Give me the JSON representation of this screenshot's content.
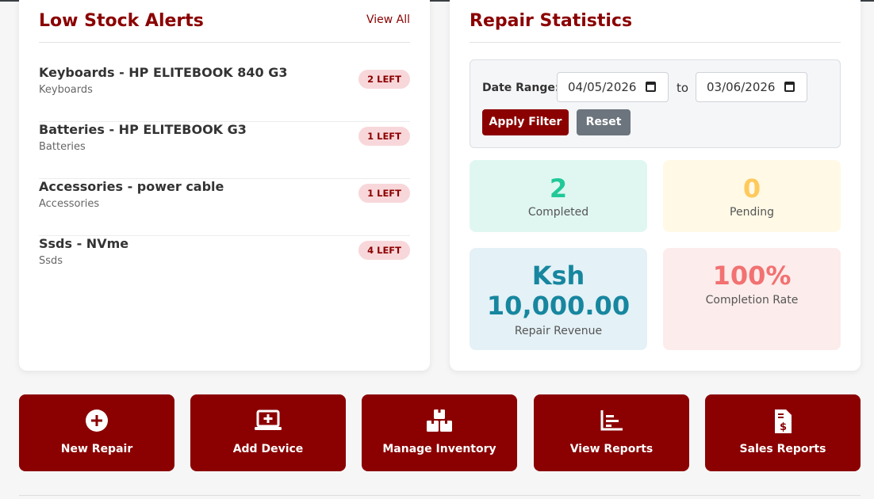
{
  "low_stock": {
    "title": "Low Stock Alerts",
    "view_all": "View All",
    "items": [
      {
        "name": "Keyboards - HP ELITEBOOK 840 G3",
        "category": "Keyboards",
        "badge": "2 LEFT"
      },
      {
        "name": "Batteries - HP ELITEBOOK G3",
        "category": "Batteries",
        "badge": "1 LEFT"
      },
      {
        "name": "Accessories - power cable",
        "category": "Accessories",
        "badge": "1 LEFT"
      },
      {
        "name": "Ssds - NVme",
        "category": "Ssds",
        "badge": "4 LEFT"
      }
    ]
  },
  "repair_stats": {
    "title": "Repair Statistics",
    "filter": {
      "label": "Date Range:",
      "from": "04/05/2026",
      "to_label": "to",
      "to": "03/06/2026",
      "apply": "Apply Filter",
      "reset": "Reset"
    },
    "stats": {
      "completed": {
        "value": "2",
        "label": "Completed"
      },
      "pending": {
        "value": "0",
        "label": "Pending"
      },
      "revenue": {
        "value_line1": "Ksh",
        "value_line2": "10,000.00",
        "label": "Repair Revenue"
      },
      "rate": {
        "value": "100%",
        "label": "Completion Rate"
      }
    }
  },
  "actions": [
    {
      "label": "New Repair",
      "icon": "plus-circle-icon"
    },
    {
      "label": "Add Device",
      "icon": "laptop-plus-icon"
    },
    {
      "label": "Manage Inventory",
      "icon": "boxes-icon"
    },
    {
      "label": "View Reports",
      "icon": "chart-icon"
    },
    {
      "label": "Sales Reports",
      "icon": "invoice-dollar-icon"
    }
  ],
  "colors": {
    "brand": "#8b0000",
    "badge_bg": "#f8d7da",
    "completed": "#20c997",
    "pending": "#ffc95c",
    "revenue": "#17869f",
    "rate": "#f27171",
    "reset_button": "#6c757d"
  }
}
